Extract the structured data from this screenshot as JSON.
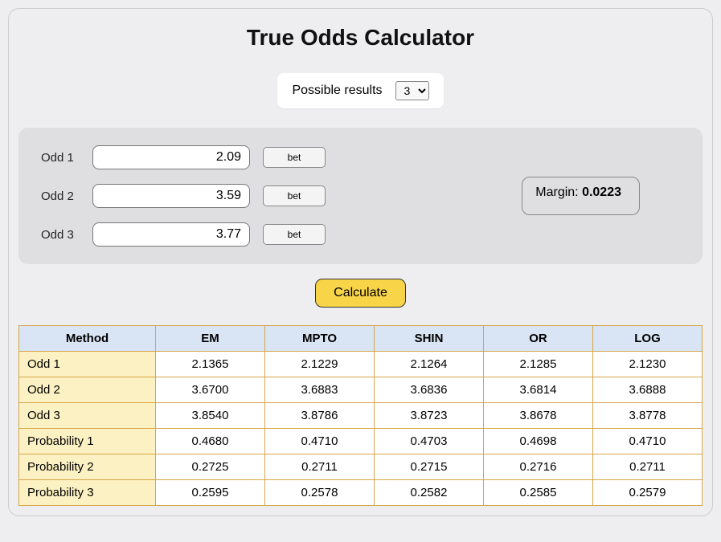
{
  "title": "True Odds Calculator",
  "possible": {
    "label": "Possible results",
    "value": "3"
  },
  "odds": [
    {
      "label": "Odd 1",
      "value": "2.09",
      "bet": "bet"
    },
    {
      "label": "Odd 2",
      "value": "3.59",
      "bet": "bet"
    },
    {
      "label": "Odd 3",
      "value": "3.77",
      "bet": "bet"
    }
  ],
  "margin": {
    "label": "Margin: ",
    "value": "0.0223"
  },
  "calculate": "Calculate",
  "table": {
    "headers": [
      "Method",
      "EM",
      "MPTO",
      "SHIN",
      "OR",
      "LOG"
    ],
    "rows": [
      {
        "label": "Odd 1",
        "cells": [
          "2.1365",
          "2.1229",
          "2.1264",
          "2.1285",
          "2.1230"
        ]
      },
      {
        "label": "Odd 2",
        "cells": [
          "3.6700",
          "3.6883",
          "3.6836",
          "3.6814",
          "3.6888"
        ]
      },
      {
        "label": "Odd 3",
        "cells": [
          "3.8540",
          "3.8786",
          "3.8723",
          "3.8678",
          "3.8778"
        ]
      },
      {
        "label": "Probability 1",
        "cells": [
          "0.4680",
          "0.4710",
          "0.4703",
          "0.4698",
          "0.4710"
        ]
      },
      {
        "label": "Probability 2",
        "cells": [
          "0.2725",
          "0.2711",
          "0.2715",
          "0.2716",
          "0.2711"
        ]
      },
      {
        "label": "Probability 3",
        "cells": [
          "0.2595",
          "0.2578",
          "0.2582",
          "0.2585",
          "0.2579"
        ]
      }
    ]
  }
}
